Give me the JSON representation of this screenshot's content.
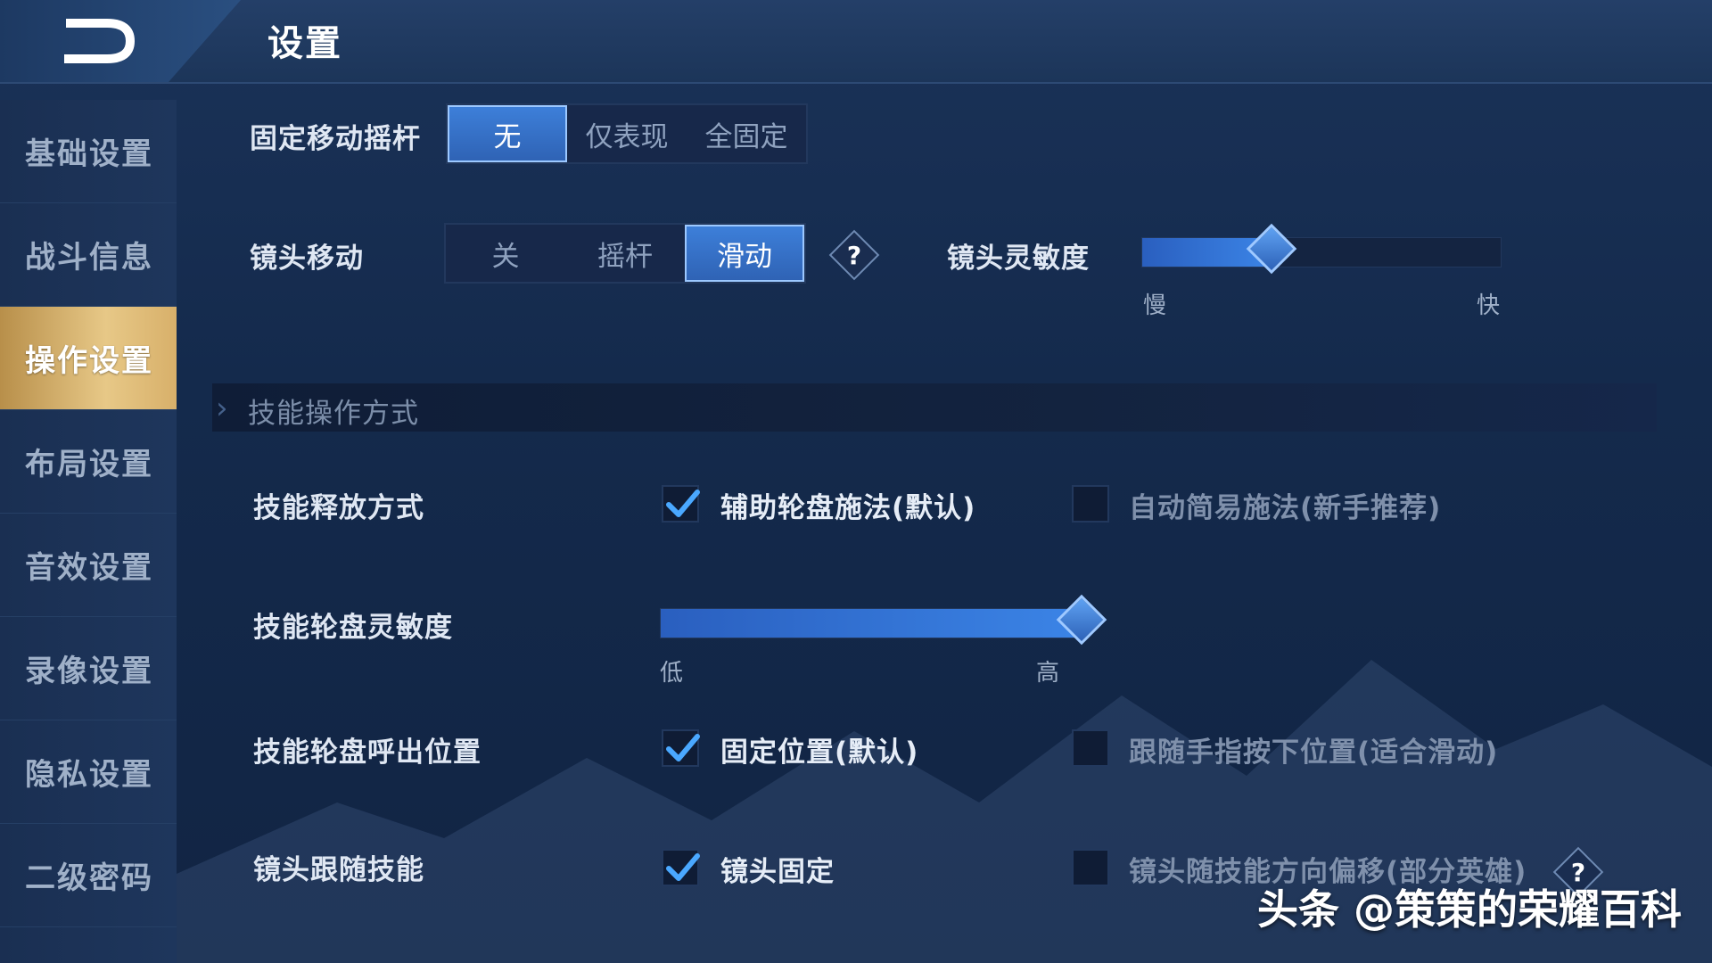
{
  "header": {
    "title": "设置"
  },
  "sidebar": {
    "items": [
      {
        "label": "基础设置"
      },
      {
        "label": "战斗信息"
      },
      {
        "label": "操作设置"
      },
      {
        "label": "布局设置"
      },
      {
        "label": "音效设置"
      },
      {
        "label": "录像设置"
      },
      {
        "label": "隐私设置"
      },
      {
        "label": "二级密码"
      }
    ],
    "active_index": 2
  },
  "joystick": {
    "label": "固定移动摇杆",
    "options": [
      "无",
      "仅表现",
      "全固定"
    ],
    "selected": "无"
  },
  "camera_move": {
    "label": "镜头移动",
    "options": [
      "关",
      "摇杆",
      "滑动"
    ],
    "selected": "滑动",
    "help": "?"
  },
  "camera_sensitivity": {
    "label": "镜头灵敏度",
    "min_label": "慢",
    "max_label": "快",
    "value": 0.36
  },
  "skill_section": {
    "title": "技能操作方式"
  },
  "skill_cast": {
    "label": "技能释放方式",
    "option_a": "辅助轮盘施法(默认)",
    "option_a_checked": true,
    "option_b": "自动简易施法(新手推荐)",
    "option_b_checked": false
  },
  "wheel_sensitivity": {
    "label": "技能轮盘灵敏度",
    "min_label": "低",
    "max_label": "高",
    "value": 1.0
  },
  "wheel_position": {
    "label": "技能轮盘呼出位置",
    "option_a": "固定位置(默认)",
    "option_a_checked": true,
    "option_b": "跟随手指按下位置(适合滑动)",
    "option_b_checked": false
  },
  "camera_follow": {
    "label": "镜头跟随技能",
    "option_a": "镜头固定",
    "option_a_checked": true,
    "option_b": "镜头随技能方向偏移(部分英雄)",
    "option_b_checked": false,
    "help": "?"
  },
  "watermark": "头条 @策策的荣耀百科",
  "colors": {
    "accent_blue": "#3b84e6",
    "active_gold": "#e7c887",
    "background": "#142a4c"
  }
}
